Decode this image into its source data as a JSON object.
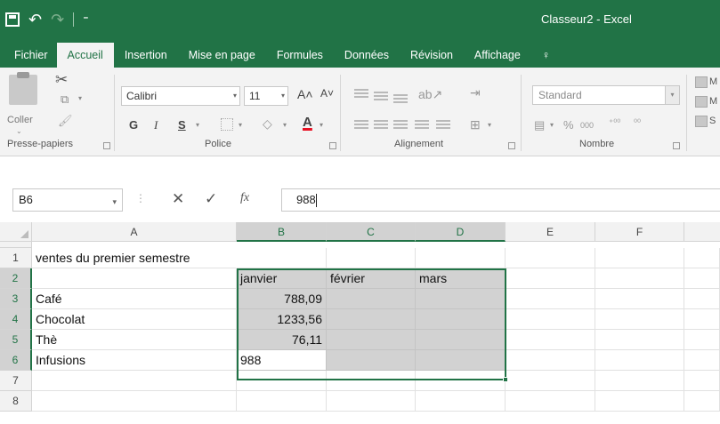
{
  "window": {
    "title": "Classeur2 - Excel"
  },
  "qat": {
    "save_icon": "save-icon",
    "undo_icon": "↶",
    "redo_icon": "↷",
    "customize_icon": "⁼"
  },
  "ribbon": {
    "tabs": [
      {
        "label": "Fichier"
      },
      {
        "label": "Accueil"
      },
      {
        "label": "Insertion"
      },
      {
        "label": "Mise en page"
      },
      {
        "label": "Formules"
      },
      {
        "label": "Données"
      },
      {
        "label": "Révision"
      },
      {
        "label": "Affichage"
      },
      {
        "label": "♀"
      }
    ],
    "clipboard": {
      "label": "Presse-papiers",
      "paste_label": "Coller"
    },
    "font": {
      "label": "Police",
      "font_name": "Calibri",
      "font_size": "11",
      "grow": "A˄",
      "shrink": "A˅",
      "bold": "G",
      "italic": "I",
      "underline": "S",
      "font_color_glyph": "A"
    },
    "alignment": {
      "label": "Alignement"
    },
    "number": {
      "label": "Nombre",
      "format": "Standard",
      "percent": "%",
      "thousands": "000",
      "inc_decimal": "⁺⁰⁰",
      "dec_decimal": "⁰⁰"
    },
    "styles": {
      "items": [
        "M",
        "M",
        "S"
      ]
    }
  },
  "formula_bar": {
    "name_box": "B6",
    "fx": "fx",
    "value": "988"
  },
  "grid": {
    "columns": [
      "A",
      "B",
      "C",
      "D",
      "E",
      "F"
    ],
    "rows": [
      "1",
      "2",
      "3",
      "4",
      "5",
      "6",
      "7",
      "8"
    ],
    "cells": {
      "A1": "ventes du premier semestre",
      "B2": "janvier",
      "C2": "février",
      "D2": "mars",
      "A3": "Café",
      "B3": "788,09",
      "A4": "Chocolat",
      "B4": "1233,56",
      "A5": "Thè",
      "B5": "76,11",
      "A6": "Infusions",
      "B6": "988"
    },
    "selection": "B2:D6",
    "active_cell": "B6"
  },
  "colors": {
    "accent": "#217346",
    "selection_fill": "#d2d2d2"
  }
}
